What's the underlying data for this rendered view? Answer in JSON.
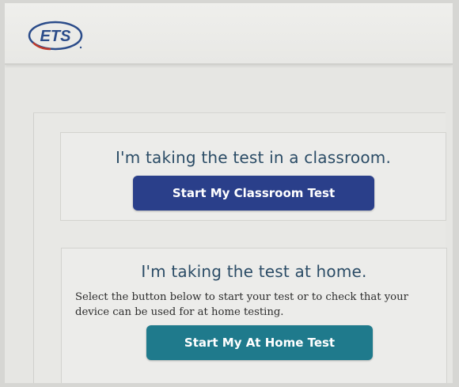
{
  "brand": {
    "logo_text": "ETS",
    "logo_color": "#2b4c8a",
    "accent_color": "#c0392b"
  },
  "classroom": {
    "heading": "I'm taking the test in a classroom.",
    "button_label": "Start My Classroom Test",
    "button_color": "#2a3f8a"
  },
  "home": {
    "heading": "I'm taking the test at home.",
    "description": "Select the button below to start your test or to check that your device can be used for at home testing.",
    "button_label": "Start My At Home Test",
    "button_color": "#1f7a8c"
  }
}
